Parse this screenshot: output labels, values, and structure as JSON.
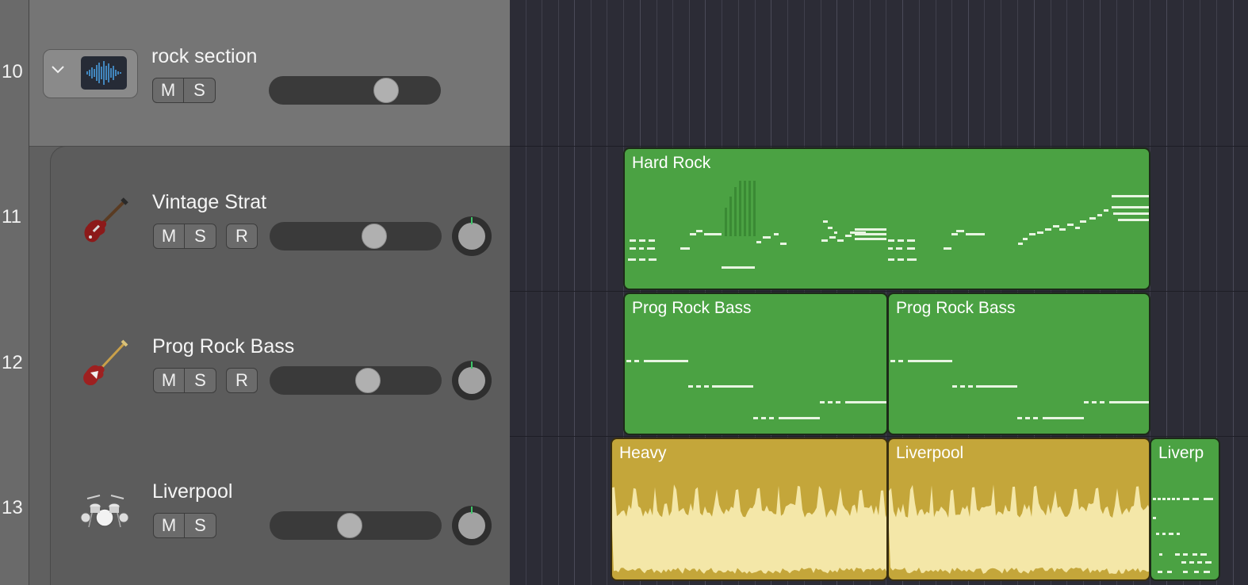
{
  "folder_track": {
    "number": "10",
    "name": "rock section",
    "mute_label": "M",
    "solo_label": "S",
    "icon": "waveform-icon",
    "collapse_icon": "chevron-down-icon",
    "volume_level": 0.68
  },
  "tracks": [
    {
      "number": "11",
      "name": "Vintage Strat",
      "mute_label": "M",
      "solo_label": "S",
      "record_label": "R",
      "icon": "electric-guitar-icon",
      "volume_level": 0.6
    },
    {
      "number": "12",
      "name": "Prog Rock Bass",
      "mute_label": "M",
      "solo_label": "S",
      "record_label": "R",
      "icon": "bass-guitar-icon",
      "volume_level": 0.57
    },
    {
      "number": "13",
      "name": "Liverpool",
      "mute_label": "M",
      "solo_label": "S",
      "icon": "drum-kit-icon",
      "volume_level": 0.46
    }
  ],
  "regions": {
    "hard_rock": "Hard Rock",
    "prog_bass_1": "Prog Rock Bass",
    "prog_bass_2": "Prog Rock Bass",
    "heavy": "Heavy",
    "liverpool": "Liverpool",
    "liverp": "Liverp"
  },
  "colors": {
    "midi_region": "#4ba243",
    "audio_region": "#c4a63a",
    "waveform": "#f4e7a8",
    "pan_indicator": "#3fc56a"
  }
}
